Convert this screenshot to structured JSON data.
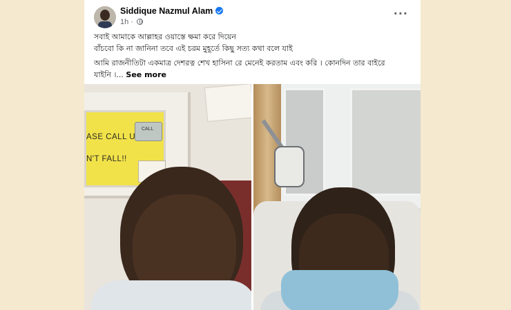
{
  "post": {
    "author": "Siddique Nazmul Alam",
    "time": "1h",
    "more_icon": "···",
    "text_line1": "সবাই আমাকে আল্লাহর ওয়াস্তে ক্ষমা করে দিয়েন",
    "text_line2": "বাঁচবো কি না জানিনা তবে এই চরম মুহূর্তে কিছু সত্য কথা বলে যাই",
    "text_line3": "আমি রাজনীতিটা একমাত্র দেশরত্ন শেখ হাসিনা রে মেনেই করতাম এবং করি । কোনদিন তার বাইরে",
    "text_line4": "যাইনি ।...",
    "see_more": "See more"
  },
  "photo1": {
    "poster_line1": "ASE CALL US",
    "poster_line2": "N'T FALL!!",
    "sticker": "CALL"
  },
  "colors": {
    "background": "#f5e9cf",
    "card": "#ffffff",
    "verified": "#1877f2",
    "meta_text": "#65676b"
  },
  "icons": [
    "verified-badge-icon",
    "globe-icon",
    "more-options-icon"
  ]
}
